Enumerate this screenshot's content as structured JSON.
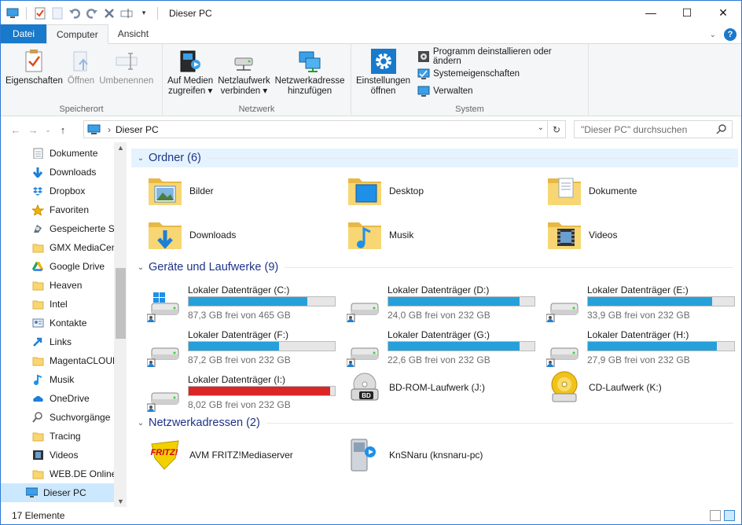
{
  "window": {
    "title": "Dieser PC",
    "minimize": "—",
    "maximize": "☐",
    "close": "✕"
  },
  "ribbon_tabs": [
    {
      "label": "Datei"
    },
    {
      "label": "Computer"
    },
    {
      "label": "Ansicht"
    }
  ],
  "ribbon": {
    "speicherort": {
      "label": "Speicherort",
      "buttons": [
        {
          "line1": "Eigenschaften",
          "line2": "",
          "icon": "properties-icon"
        },
        {
          "line1": "Öffnen",
          "line2": "",
          "icon": "open-icon"
        },
        {
          "line1": "Umbenennen",
          "line2": "",
          "icon": "rename-icon"
        }
      ]
    },
    "netzwerk": {
      "label": "Netzwerk",
      "buttons": [
        {
          "line1": "Auf Medien",
          "line2": "zugreifen ▾",
          "icon": "media-icon"
        },
        {
          "line1": "Netzlaufwerk",
          "line2": "verbinden ▾",
          "icon": "map-network-drive-icon"
        },
        {
          "line1": "Netzwerkadresse",
          "line2": "hinzufügen",
          "icon": "network-location-icon"
        }
      ]
    },
    "system": {
      "label": "System",
      "big": {
        "line1": "Einstellungen",
        "line2": "öffnen",
        "icon": "settings-gear-icon"
      },
      "small": [
        {
          "label": "Programm deinstallieren oder ändern",
          "icon": "uninstall-icon"
        },
        {
          "label": "Systemeigenschaften",
          "icon": "system-properties-icon"
        },
        {
          "label": "Verwalten",
          "icon": "manage-icon"
        }
      ]
    }
  },
  "address": {
    "path": "Dieser PC",
    "search_placeholder": "\"Dieser PC\" durchsuchen"
  },
  "nav_items": [
    {
      "label": "Dokumente",
      "icon": "documents-icon"
    },
    {
      "label": "Downloads",
      "icon": "downloads-icon"
    },
    {
      "label": "Dropbox",
      "icon": "dropbox-icon"
    },
    {
      "label": "Favoriten",
      "icon": "favorites-icon"
    },
    {
      "label": "Gespeicherte Sp",
      "icon": "saved-games-icon"
    },
    {
      "label": "GMX MediaCen",
      "icon": "folder-icon"
    },
    {
      "label": "Google Drive",
      "icon": "google-drive-icon"
    },
    {
      "label": "Heaven",
      "icon": "folder-icon"
    },
    {
      "label": "Intel",
      "icon": "folder-icon"
    },
    {
      "label": "Kontakte",
      "icon": "contacts-icon"
    },
    {
      "label": "Links",
      "icon": "links-icon"
    },
    {
      "label": "MagentaCLOUD",
      "icon": "folder-icon"
    },
    {
      "label": "Musik",
      "icon": "music-icon"
    },
    {
      "label": "OneDrive",
      "icon": "onedrive-icon"
    },
    {
      "label": "Suchvorgänge",
      "icon": "search-icon"
    },
    {
      "label": "Tracing",
      "icon": "folder-icon"
    },
    {
      "label": "Videos",
      "icon": "videos-icon"
    },
    {
      "label": "WEB.DE Online-",
      "icon": "folder-icon"
    },
    {
      "label": "Dieser PC",
      "icon": "this-pc-icon"
    }
  ],
  "groups": {
    "folders": "Ordner (6)",
    "devices": "Geräte und Laufwerke (9)",
    "network": "Netzwerkadressen (2)"
  },
  "folders": [
    {
      "label": "Bilder",
      "icon": "pictures-folder-icon"
    },
    {
      "label": "Desktop",
      "icon": "desktop-folder-icon"
    },
    {
      "label": "Dokumente",
      "icon": "documents-folder-icon"
    },
    {
      "label": "Downloads",
      "icon": "downloads-folder-icon"
    },
    {
      "label": "Musik",
      "icon": "music-folder-icon"
    },
    {
      "label": "Videos",
      "icon": "videos-folder-icon"
    }
  ],
  "drives": [
    {
      "name": "Lokaler Datenträger (C:)",
      "free": "87,3 GB frei von 465 GB",
      "used_fraction": 0.81,
      "warning": false,
      "icon": "windows-drive-icon"
    },
    {
      "name": "Lokaler Datenträger (D:)",
      "free": "24,0 GB frei von 232 GB",
      "used_fraction": 0.9,
      "warning": false,
      "icon": "hard-drive-icon"
    },
    {
      "name": "Lokaler Datenträger (E:)",
      "free": "33,9 GB frei von 232 GB",
      "used_fraction": 0.85,
      "warning": false,
      "icon": "hard-drive-icon"
    },
    {
      "name": "Lokaler Datenträger (F:)",
      "free": "87,2 GB frei von 232 GB",
      "used_fraction": 0.62,
      "warning": false,
      "icon": "hard-drive-icon"
    },
    {
      "name": "Lokaler Datenträger (G:)",
      "free": "22,6 GB frei von 232 GB",
      "used_fraction": 0.9,
      "warning": false,
      "icon": "hard-drive-icon"
    },
    {
      "name": "Lokaler Datenträger (H:)",
      "free": "27,9 GB frei von 232 GB",
      "used_fraction": 0.88,
      "warning": false,
      "icon": "hard-drive-icon"
    },
    {
      "name": "Lokaler Datenträger (I:)",
      "free": "8,02 GB frei von 232 GB",
      "used_fraction": 0.97,
      "warning": true,
      "icon": "hard-drive-icon"
    }
  ],
  "other_drives": [
    {
      "name": "BD-ROM-Laufwerk (J:)",
      "icon": "bd-rom-icon",
      "badge": "BD"
    },
    {
      "name": "CD-Laufwerk (K:)",
      "icon": "cd-drive-icon"
    }
  ],
  "network_locations": [
    {
      "label": "AVM FRITZ!Mediaserver",
      "icon": "fritz-icon",
      "logo": "FRITZ!"
    },
    {
      "label": "KnSNaru (knsnaru-pc)",
      "icon": "media-server-icon"
    }
  ],
  "status": {
    "count": "17 Elemente"
  },
  "colors": {
    "accent": "#1979ca",
    "drive_bar": "#26a0da",
    "drive_bar_warning": "#da2626",
    "group_header": "#1e3287"
  }
}
